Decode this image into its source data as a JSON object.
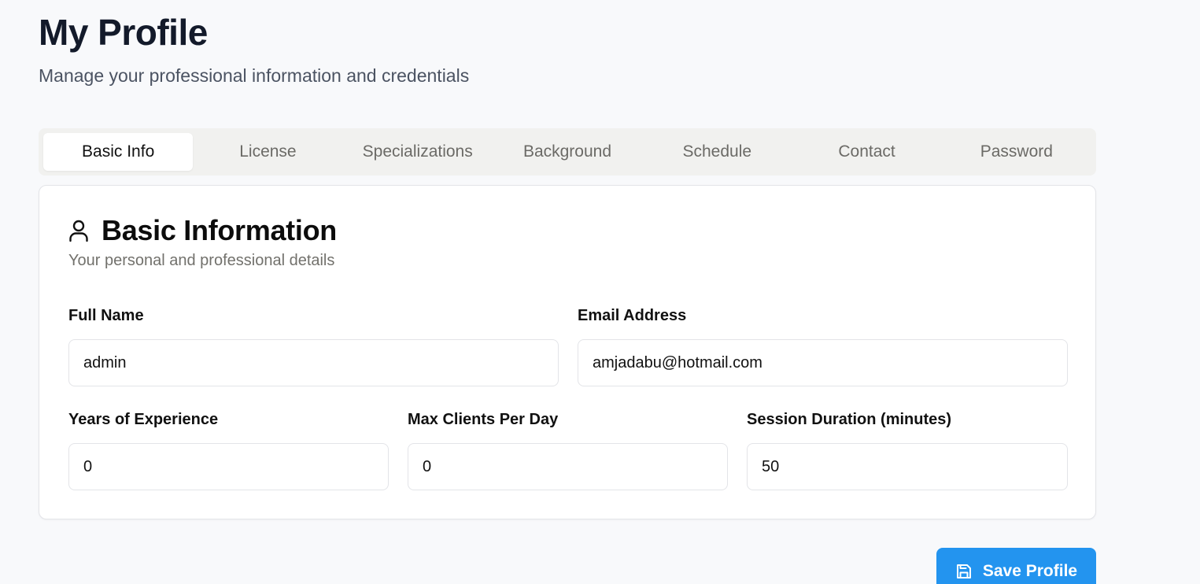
{
  "header": {
    "title": "My Profile",
    "subtitle": "Manage your professional information and credentials"
  },
  "tabs": [
    {
      "label": "Basic Info",
      "active": true
    },
    {
      "label": "License",
      "active": false
    },
    {
      "label": "Specializations",
      "active": false
    },
    {
      "label": "Background",
      "active": false
    },
    {
      "label": "Schedule",
      "active": false
    },
    {
      "label": "Contact",
      "active": false
    },
    {
      "label": "Password",
      "active": false
    }
  ],
  "card": {
    "icon": "user-icon",
    "title": "Basic Information",
    "subtitle": "Your personal and professional details"
  },
  "fields": {
    "full_name": {
      "label": "Full Name",
      "value": "admin"
    },
    "email": {
      "label": "Email Address",
      "value": "amjadabu@hotmail.com"
    },
    "years_experience": {
      "label": "Years of Experience",
      "value": "0"
    },
    "max_clients": {
      "label": "Max Clients Per Day",
      "value": "0"
    },
    "session_duration": {
      "label": "Session Duration (minutes)",
      "value": "50"
    }
  },
  "actions": {
    "save_label": "Save Profile",
    "save_icon": "save-icon"
  },
  "colors": {
    "accent": "#2394ef",
    "title": "#131a2a",
    "tab_bar": "#f1f1ef"
  }
}
